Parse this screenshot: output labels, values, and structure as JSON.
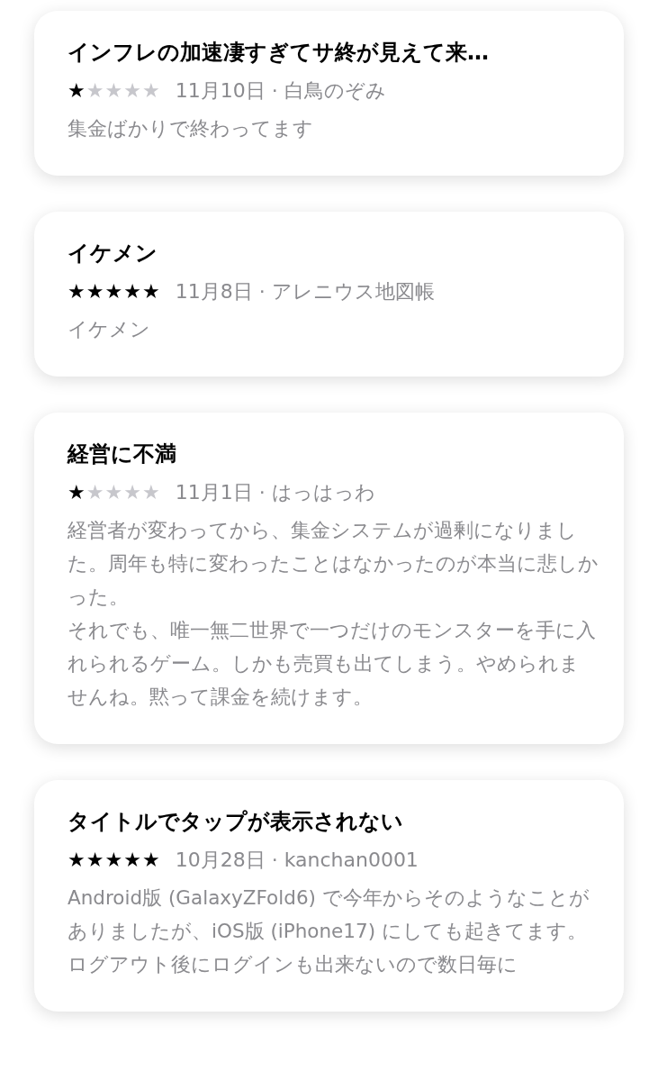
{
  "reviews": [
    {
      "title": "インフレの加速凄すぎてサ終が見えて来…",
      "stars": 1,
      "meta": "11月10日 · 白鳥のぞみ",
      "body": [
        "集金ばかりで終わってます"
      ]
    },
    {
      "title": "イケメン",
      "stars": 5,
      "meta": "11月8日 · アレニウス地図帳",
      "body": [
        "イケメン"
      ]
    },
    {
      "title": "経営に不満",
      "stars": 1,
      "meta": "11月1日 · はっはっわ",
      "body": [
        "経営者が変わってから、集金システムが過剰になりました。周年も特に変わったことはなかったのが本当に悲しかった。",
        "それでも、唯一無二世界で一つだけのモンスターを手に入れられるゲーム。しかも売買も出てしまう。やめられませんね。黙って課金を続けます。"
      ]
    },
    {
      "title": "タイトルでタップが表示されない",
      "stars": 5,
      "meta": "10月28日 · kanchan0001",
      "body": [
        "Android版 (GalaxyZFold6) で今年からそのようなことがありましたが、iOS版 (iPhone17) にしても起きてます。",
        "ログアウト後にログインも出来ないので数日毎に"
      ]
    }
  ]
}
